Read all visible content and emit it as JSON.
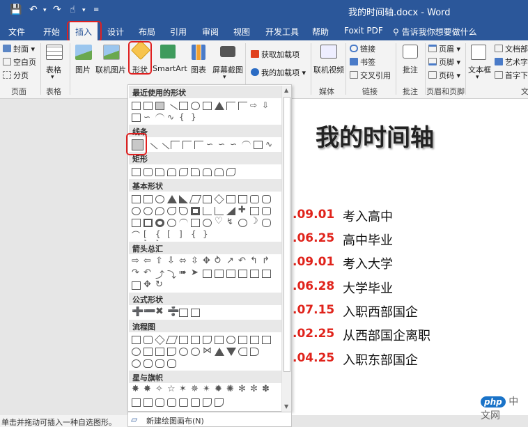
{
  "window": {
    "title": "我的时间轴.docx - Word"
  },
  "tabs": [
    {
      "label": "文件"
    },
    {
      "label": "开始"
    },
    {
      "label": "插入"
    },
    {
      "label": "设计"
    },
    {
      "label": "布局"
    },
    {
      "label": "引用"
    },
    {
      "label": "审阅"
    },
    {
      "label": "视图"
    },
    {
      "label": "开发工具"
    },
    {
      "label": "帮助"
    },
    {
      "label": "Foxit PDF"
    }
  ],
  "tellme": {
    "label": "告诉我你想要做什么"
  },
  "ribbon": {
    "pages": {
      "cover": "封面",
      "blank": "空白页",
      "break": "分页",
      "label": "页面"
    },
    "tables": {
      "table": "表格",
      "label": "表格"
    },
    "illustrations": {
      "picture": "图片",
      "online_picture": "联机图片",
      "shapes": "形状",
      "smartart": "SmartArt",
      "chart": "图表",
      "screenshot": "屏幕截图"
    },
    "addins": {
      "get": "获取加载项",
      "my": "我的加载项"
    },
    "media": {
      "online_video": "联机视频",
      "label": "媒体"
    },
    "links": {
      "link": "链接",
      "bookmark": "书签",
      "crossref": "交叉引用",
      "label": "链接"
    },
    "comments": {
      "comment": "批注",
      "label": "批注"
    },
    "header_footer": {
      "header": "页眉",
      "footer": "页脚",
      "page_number": "页码",
      "label": "页眉和页脚"
    },
    "text": {
      "textbox": "文本框",
      "quickparts": "文档部",
      "wordart": "艺术字",
      "dropcap": "首字下",
      "label": "文"
    }
  },
  "shapes_menu": {
    "sections": [
      {
        "title": "最近使用的形状"
      },
      {
        "title": "线条"
      },
      {
        "title": "矩形"
      },
      {
        "title": "基本形状"
      },
      {
        "title": "箭头总汇"
      },
      {
        "title": "公式形状"
      },
      {
        "title": "流程图"
      },
      {
        "title": "星与旗帜"
      }
    ],
    "new_canvas": "新建绘图画布(N)"
  },
  "document": {
    "title": "我的时间轴",
    "timeline": [
      {
        "date": ".09.01",
        "event": "考入高中"
      },
      {
        "date": ".06.25",
        "event": "高中毕业"
      },
      {
        "date": ".09.01",
        "event": "考入大学"
      },
      {
        "date": ".06.28",
        "event": "大学毕业"
      },
      {
        "date": ".07.15",
        "event": "入职西部国企"
      },
      {
        "date": ".02.25",
        "event": "从西部国企离职"
      },
      {
        "date": ".04.25",
        "event": "入职东部国企"
      }
    ]
  },
  "status": {
    "text": "单击并拖动可插入一种自选图形。"
  },
  "watermark": {
    "brand": "php",
    "site": "中文网"
  },
  "colors": {
    "brand": "#2b579a",
    "date_red": "#e0231b",
    "highlight_red": "#e02020"
  }
}
